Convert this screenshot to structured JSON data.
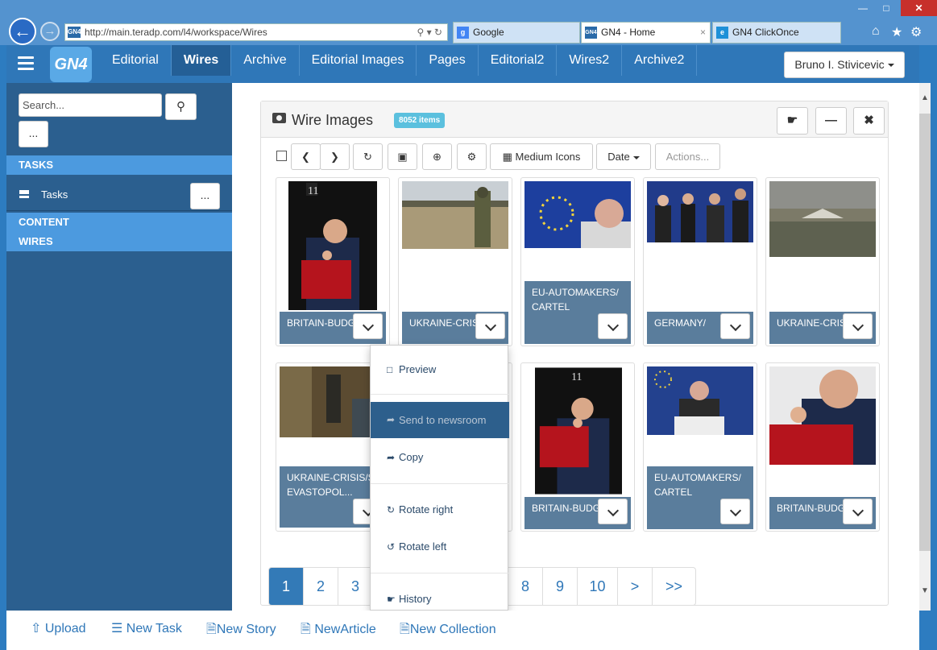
{
  "browser": {
    "address": "http://main.teradp.com/l4/workspace/Wires",
    "tabs": [
      {
        "label": "Google",
        "icon": "google-icon"
      },
      {
        "label": "GN4 - Home",
        "icon": "gn4-icon"
      },
      {
        "label": "GN4 ClickOnce",
        "icon": "ie-icon"
      }
    ],
    "favicon_text": "GN4"
  },
  "app": {
    "logo": "GN4",
    "nav": [
      "Editorial",
      "Wires",
      "Archive",
      "Editorial Images",
      "Pages",
      "Editorial2",
      "Wires2",
      "Archive2"
    ],
    "user": "Bruno I. Stivicevic"
  },
  "sidebar": {
    "search_placeholder": "Search...",
    "more": "...",
    "tasks_header": "TASKS",
    "tasks_item": "Tasks",
    "content_header": "CONTENT",
    "wires_header": "WIRES"
  },
  "panel": {
    "title": "Wire Images",
    "badge": "8052 items",
    "toolbar": {
      "view": "Medium Icons",
      "sort": "Date",
      "actions": "Actions..."
    }
  },
  "cards": [
    {
      "caption": "BRITAIN-BUDGET",
      "thumb": "budget-portrait"
    },
    {
      "caption": "UKRAINE-CRISIS",
      "thumb": "field-soldier"
    },
    {
      "caption": "EU-AUTOMAKERS/CARTEL",
      "thumb": "eu-speaker"
    },
    {
      "caption": "GERMANY/",
      "thumb": "group-meeting"
    },
    {
      "caption": "UKRAINE-CRISIS",
      "thumb": "military-camp"
    },
    {
      "caption": "UKRAINE-CRISIS/SEVASTOPOL...",
      "thumb": "room-interior"
    },
    {
      "caption": "",
      "thumb": "hidden"
    },
    {
      "caption": "BRITAIN-BUDGET",
      "thumb": "budget-portrait"
    },
    {
      "caption": "EU-AUTOMAKERS/CARTEL",
      "thumb": "eu-podium"
    },
    {
      "caption": "BRITAIN-BUDGET",
      "thumb": "budget-closeup"
    }
  ],
  "context_menu": [
    {
      "label": "Preview",
      "icon": "preview-icon"
    },
    {
      "label": "Send to newsroom",
      "icon": "share-icon"
    },
    {
      "label": "Copy",
      "icon": "share-icon"
    },
    {
      "label": "Rotate right",
      "icon": "rotate-right-icon"
    },
    {
      "label": "Rotate left",
      "icon": "rotate-left-icon"
    },
    {
      "label": "History",
      "icon": "hand-icon"
    }
  ],
  "pager": [
    "1",
    "2",
    "3",
    "8",
    "9",
    "10",
    ">",
    ">>"
  ],
  "footer": [
    "Upload",
    "New Task",
    "New Story",
    "NewArticle",
    "New Collection"
  ]
}
